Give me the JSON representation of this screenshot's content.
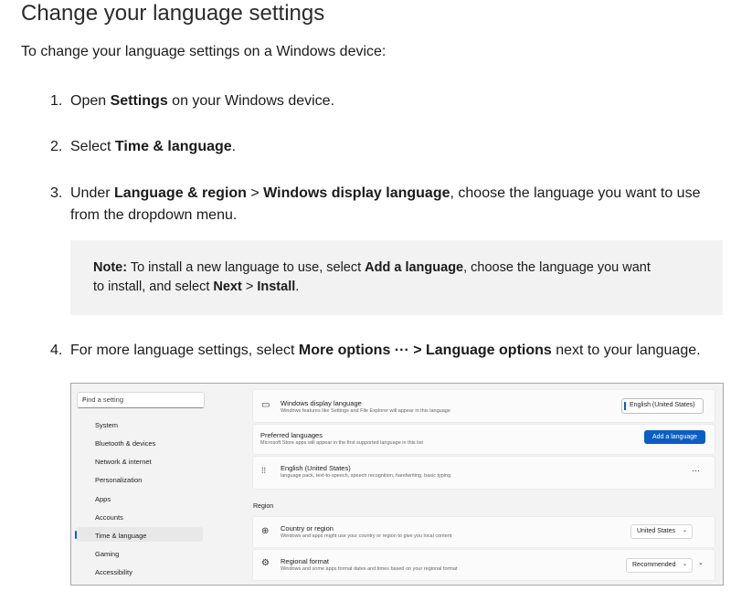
{
  "page": {
    "title": "Change your language settings",
    "intro": "To change your language settings on a Windows device:",
    "steps": {
      "s1": {
        "num": "1.",
        "a": "Open ",
        "b": "Settings",
        "c": " on your Windows device."
      },
      "s2": {
        "num": "2.",
        "a": "Select ",
        "b": "Time & language",
        "c": "."
      },
      "s3": {
        "num": "3.",
        "a": "Under ",
        "b": "Language & region",
        "c": " > ",
        "d": "Windows display language",
        "e": ", choose the language you want to use from the dropdown menu."
      },
      "s4": {
        "num": "4.",
        "a": "For more language settings, select ",
        "b": "More options ··· > Language options",
        "c": " next to your language."
      }
    },
    "note": {
      "label": "Note:",
      "a": " To install a new language to use, select ",
      "b": "Add a language",
      "c": ", choose the language you want to install, and select ",
      "d": "Next",
      "e": " > ",
      "f": "Install",
      "g": "."
    }
  },
  "screenshot": {
    "search_placeholder": "Find a setting",
    "search_icon": "search-icon",
    "nav": [
      "System",
      "Bluetooth & devices",
      "Network & internet",
      "Personalization",
      "Apps",
      "Accounts",
      "Time & language",
      "Gaming",
      "Accessibility"
    ],
    "selected_nav": "Time & language",
    "display_language": {
      "title": "Windows display language",
      "subtitle": "Windows features like Settings and File Explorer will appear in this language",
      "value": "English (United States)",
      "icon": "monitor-icon"
    },
    "preferred": {
      "title": "Preferred languages",
      "subtitle": "Microsoft Store apps will appear in the first supported language in this list",
      "button": "Add a language"
    },
    "lang_item": {
      "title": "English (United States)",
      "subtitle": "language pack, text-to-speech, speech recognition, handwriting, basic typing",
      "more": "···",
      "icon": "drag-handle-icon"
    },
    "region_header": "Region",
    "country": {
      "title": "Country or region",
      "subtitle": "Windows and apps might use your country or region to give you local content",
      "value": "United States",
      "icon": "globe-icon"
    },
    "format": {
      "title": "Regional format",
      "subtitle": "Windows and some apps format dates and times based on your regional format",
      "value": "Recommended",
      "icon": "regional-format-icon"
    },
    "accent_color": "#0a5ec4"
  }
}
